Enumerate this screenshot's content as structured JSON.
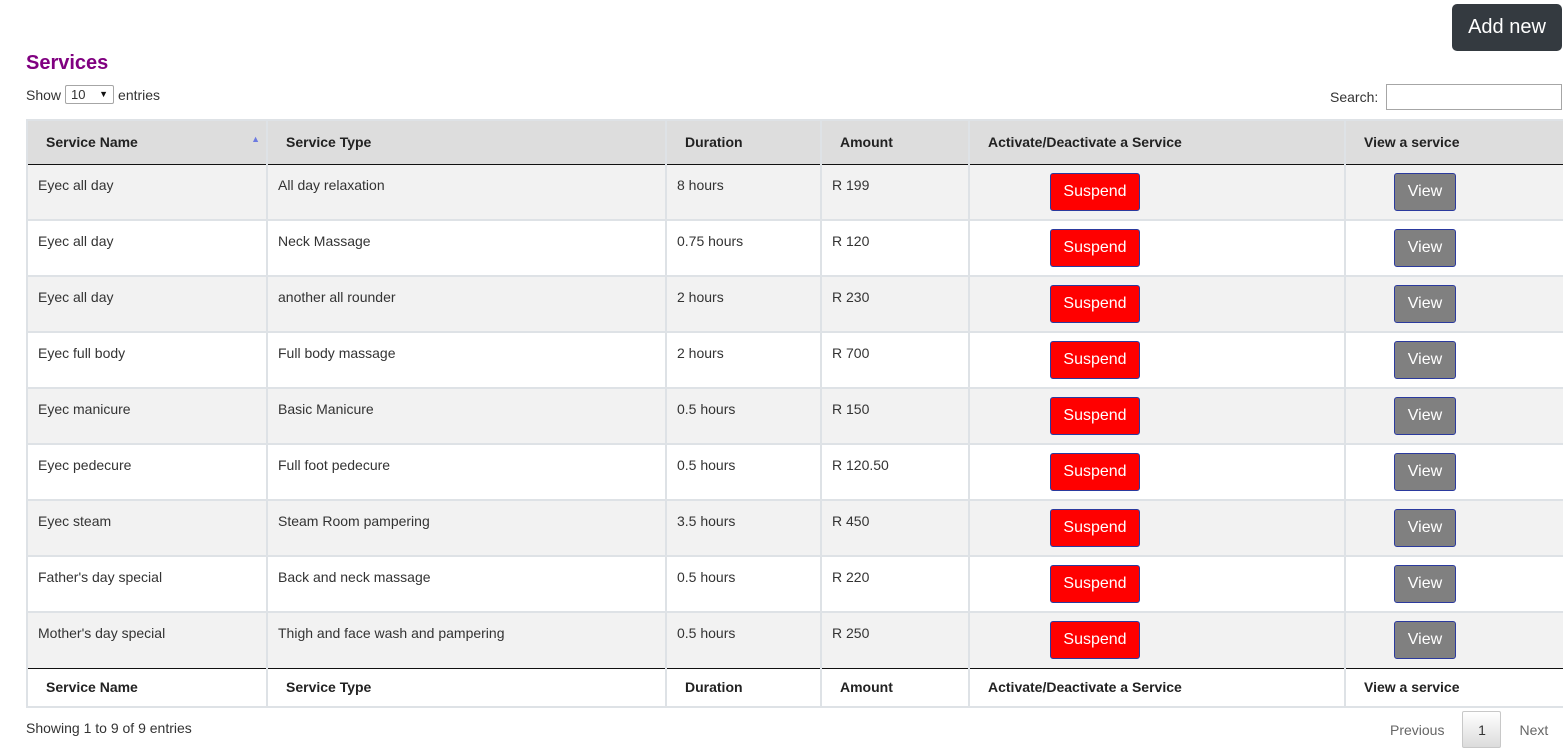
{
  "toolbar": {
    "add_new_label": "Add new"
  },
  "page": {
    "title": "Services"
  },
  "length_control": {
    "show_label": "Show",
    "selected": "10",
    "entries_label": "entries"
  },
  "search": {
    "label": "Search:",
    "value": ""
  },
  "table": {
    "columns": [
      "Service Name",
      "Service Type",
      "Duration",
      "Amount",
      "Activate/Deactivate a Service",
      "View a service"
    ],
    "sort": {
      "column": "Service Name",
      "direction": "ascending"
    },
    "rows": [
      {
        "name": "Eyec all day",
        "type": "All day relaxation",
        "duration": "8 hours",
        "amount": "R 199",
        "action": "Suspend",
        "view": "View"
      },
      {
        "name": "Eyec all day",
        "type": "Neck Massage",
        "duration": "0.75 hours",
        "amount": "R 120",
        "action": "Suspend",
        "view": "View"
      },
      {
        "name": "Eyec all day",
        "type": "another all rounder",
        "duration": "2 hours",
        "amount": "R 230",
        "action": "Suspend",
        "view": "View"
      },
      {
        "name": "Eyec full body",
        "type": "Full body massage",
        "duration": "2 hours",
        "amount": "R 700",
        "action": "Suspend",
        "view": "View"
      },
      {
        "name": "Eyec manicure",
        "type": "Basic Manicure",
        "duration": "0.5 hours",
        "amount": "R 150",
        "action": "Suspend",
        "view": "View"
      },
      {
        "name": "Eyec pedecure",
        "type": "Full foot pedecure",
        "duration": "0.5 hours",
        "amount": "R 120.50",
        "action": "Suspend",
        "view": "View"
      },
      {
        "name": "Eyec steam",
        "type": "Steam Room pampering",
        "duration": "3.5 hours",
        "amount": "R 450",
        "action": "Suspend",
        "view": "View"
      },
      {
        "name": "Father's day special",
        "type": "Back and neck massage",
        "duration": "0.5 hours",
        "amount": "R 220",
        "action": "Suspend",
        "view": "View"
      },
      {
        "name": "Mother's day special",
        "type": "Thigh and face wash and pampering",
        "duration": "0.5 hours",
        "amount": "R 250",
        "action": "Suspend",
        "view": "View"
      }
    ]
  },
  "footer": {
    "info": "Showing 1 to 9 of 9 entries",
    "previous": "Previous",
    "current_page": "1",
    "next": "Next"
  },
  "colors": {
    "title": "#800080",
    "suspend_button": "#ff0000",
    "view_button": "#808080",
    "add_new_button": "#343a40"
  }
}
